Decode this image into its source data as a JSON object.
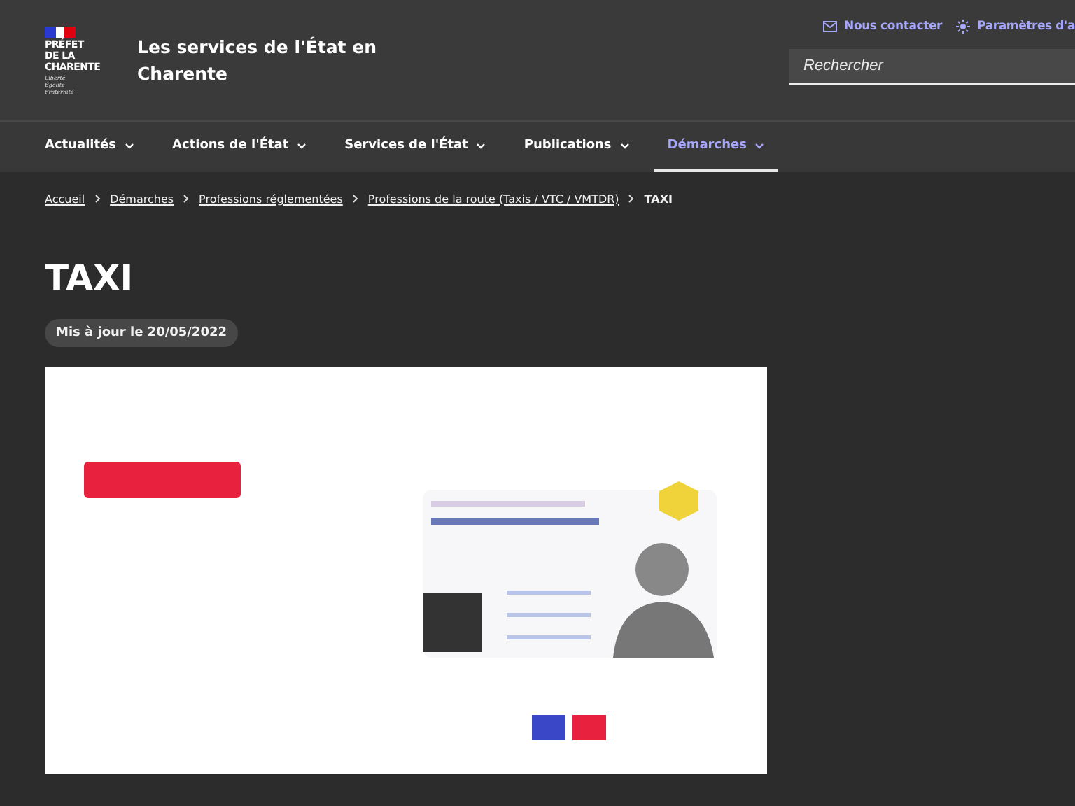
{
  "header": {
    "logo": {
      "lines": [
        "PRÉFET",
        "DE LA",
        "CHARENTE"
      ],
      "motto": [
        "Liberté",
        "Égalité",
        "Fraternité"
      ]
    },
    "site_title": "Les services de l'État en Charente",
    "links": [
      {
        "kind": "contact",
        "label": "Nous contacter"
      },
      {
        "kind": "settings",
        "label": "Paramètres d'a"
      }
    ],
    "search": {
      "placeholder": "Rechercher"
    }
  },
  "nav": [
    {
      "label": "Actualités",
      "selected": false
    },
    {
      "label": "Actions de l'État",
      "selected": false
    },
    {
      "label": "Services de l'État",
      "selected": false
    },
    {
      "label": "Publications",
      "selected": false
    },
    {
      "label": "Démarches",
      "selected": true
    }
  ],
  "breadcrumb": [
    {
      "label": "Accueil",
      "current": false
    },
    {
      "label": "Démarches",
      "current": false
    },
    {
      "label": "Professions réglementées",
      "current": false
    },
    {
      "label": "Professions de la route (Taxis / VTC / VMTDR)",
      "current": false
    },
    {
      "label": "TAXI",
      "current": true
    }
  ],
  "page": {
    "title": "TAXI",
    "updated": "Mis à jour le 20/05/2022"
  }
}
